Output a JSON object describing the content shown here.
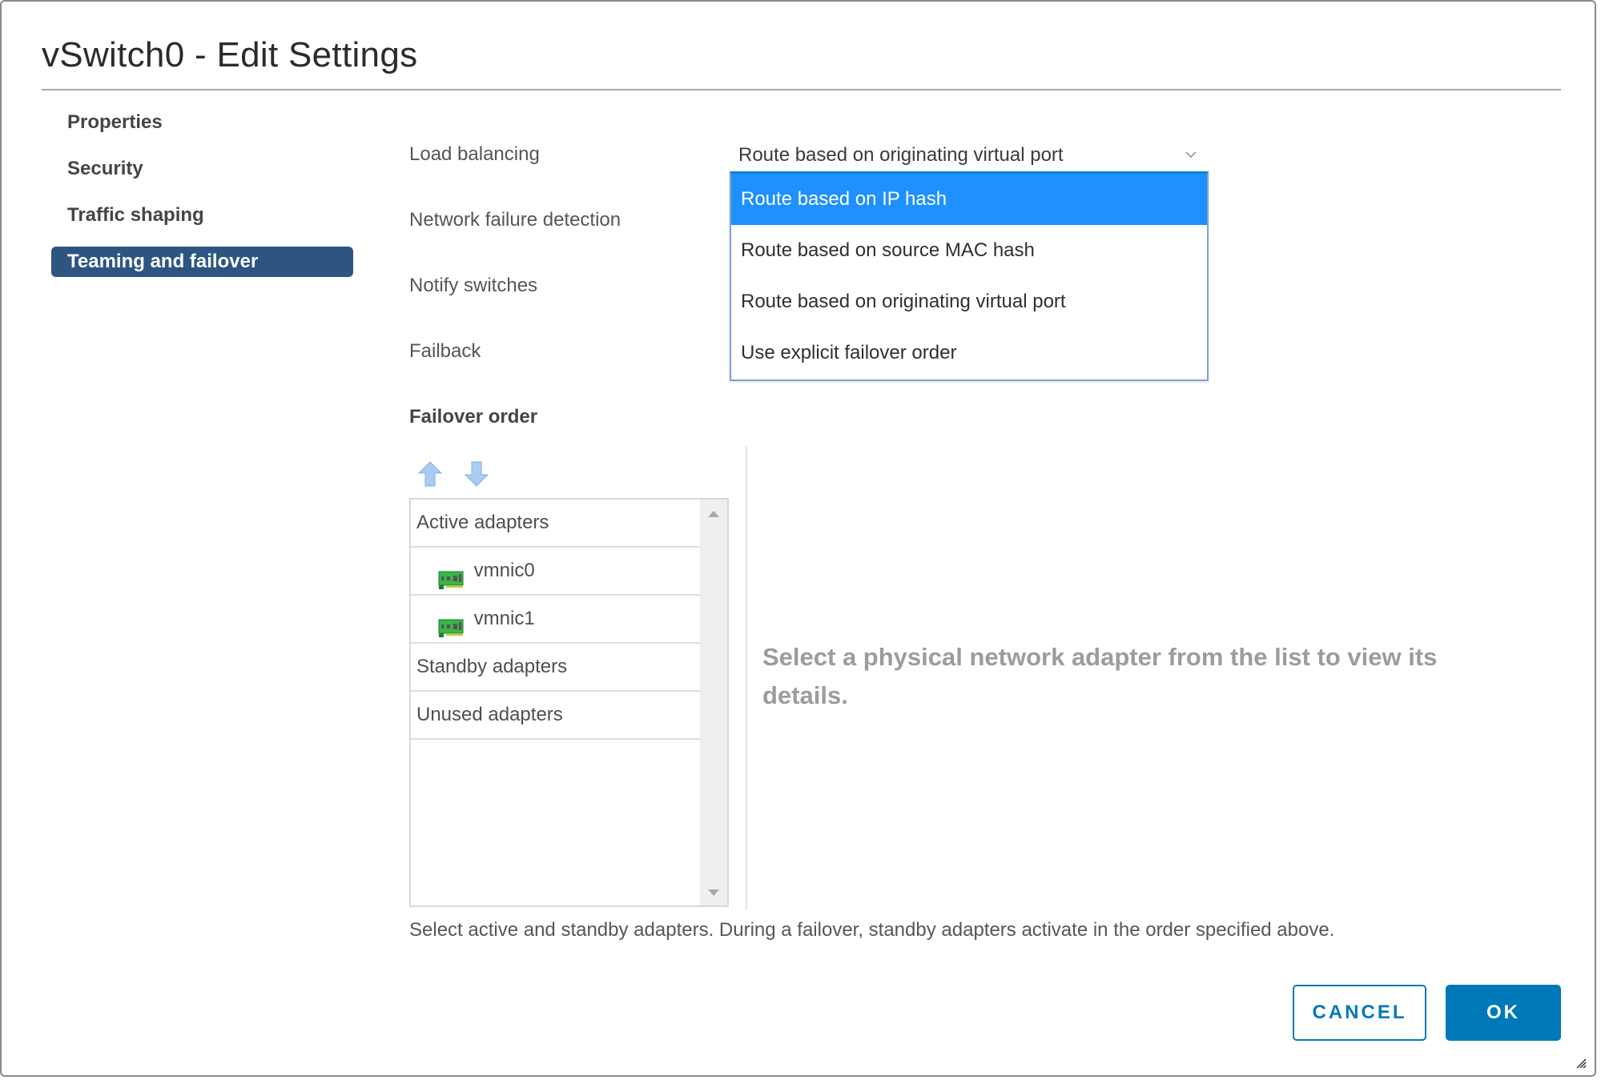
{
  "dialog": {
    "title": "vSwitch0 - Edit Settings"
  },
  "sidebar": {
    "items": [
      {
        "label": "Properties",
        "active": false
      },
      {
        "label": "Security",
        "active": false
      },
      {
        "label": "Traffic shaping",
        "active": false
      },
      {
        "label": "Teaming and failover",
        "active": true
      }
    ]
  },
  "form": {
    "load_balancing_label": "Load balancing",
    "load_balancing_value": "Route based on originating virtual port",
    "network_failure_detection_label": "Network failure detection",
    "notify_switches_label": "Notify switches",
    "failback_label": "Failback"
  },
  "load_balancing_menu": {
    "options": [
      {
        "label": "Route based on IP hash",
        "highlighted": true
      },
      {
        "label": "Route based on source MAC hash",
        "highlighted": false
      },
      {
        "label": "Route based on originating virtual port",
        "highlighted": false
      },
      {
        "label": "Use explicit failover order",
        "highlighted": false
      }
    ]
  },
  "failover": {
    "title": "Failover order",
    "move_up_icon": "arrow-up-icon",
    "move_down_icon": "arrow-down-icon",
    "groups": [
      {
        "label": "Active adapters",
        "adapters": [
          "vmnic0",
          "vmnic1"
        ]
      },
      {
        "label": "Standby adapters",
        "adapters": []
      },
      {
        "label": "Unused adapters",
        "adapters": []
      }
    ],
    "detail_placeholder": "Select a physical network adapter from the list to view its details.",
    "note": "Select active and standby adapters. During a failover, standby adapters activate in the order specified above."
  },
  "footer": {
    "cancel_label": "CANCEL",
    "ok_label": "OK"
  },
  "colors": {
    "accent": "#0079b8",
    "nav_active": "#2e5582",
    "menu_highlight": "#1e90ff"
  }
}
